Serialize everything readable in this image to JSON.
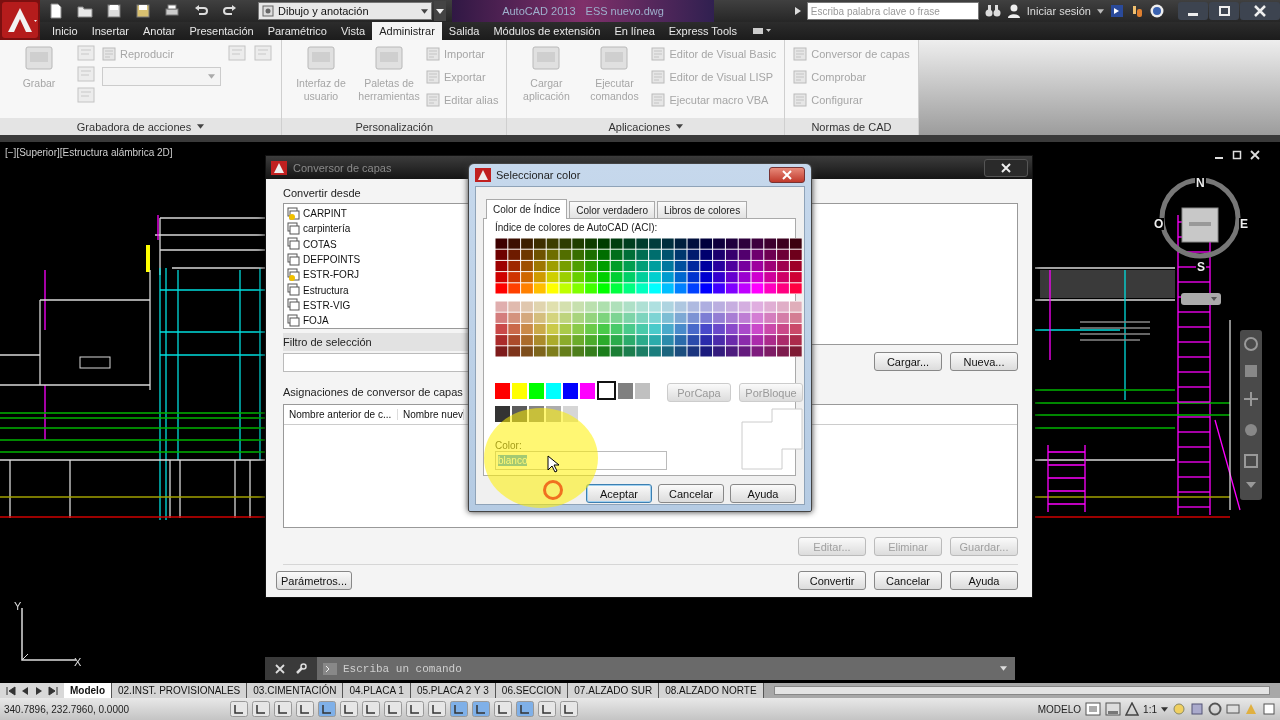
{
  "title_bar": {
    "workspace": "Dibujo y anotación",
    "app": "AutoCAD 2013",
    "file": "ESS nuevo.dwg",
    "search": {
      "placeholder": "Escriba palabra clave o frase"
    },
    "sign_in": "Iniciar sesión"
  },
  "ribbon_tabs": [
    {
      "label": "Inicio",
      "selected": false
    },
    {
      "label": "Insertar",
      "selected": false
    },
    {
      "label": "Anotar",
      "selected": false
    },
    {
      "label": "Presentación",
      "selected": false
    },
    {
      "label": "Paramétrico",
      "selected": false
    },
    {
      "label": "Vista",
      "selected": false
    },
    {
      "label": "Administrar",
      "selected": true
    },
    {
      "label": "Salida",
      "selected": false
    },
    {
      "label": "Módulos de extensión",
      "selected": false
    },
    {
      "label": "En línea",
      "selected": false
    },
    {
      "label": "Express Tools",
      "selected": false
    }
  ],
  "ribbon_panels": [
    {
      "title": "Grabadora de acciones",
      "menu": true,
      "columns": [
        [
          {
            "kind": "large",
            "label": "Grabar"
          }
        ],
        [
          {
            "kind": "icon"
          },
          {
            "kind": "icon"
          },
          {
            "kind": "icon"
          }
        ],
        [
          {
            "kind": "small",
            "label": "Reproducir"
          },
          {
            "kind": "combo"
          }
        ],
        [
          {
            "kind": "icon"
          }
        ],
        [
          {
            "kind": "icon"
          }
        ]
      ]
    },
    {
      "title": "Personalización",
      "menu": false,
      "columns": [
        [
          {
            "kind": "large",
            "label": "Interfaz de usuario"
          }
        ],
        [
          {
            "kind": "large",
            "label": "Paletas de herramientas"
          }
        ],
        [
          {
            "kind": "small",
            "label": "Importar"
          },
          {
            "kind": "small",
            "label": "Exportar"
          },
          {
            "kind": "small",
            "label": "Editar alias"
          }
        ]
      ]
    },
    {
      "title": "Aplicaciones",
      "menu": true,
      "columns": [
        [
          {
            "kind": "large",
            "label": "Cargar aplicación"
          }
        ],
        [
          {
            "kind": "large",
            "label": "Ejecutar comandos"
          }
        ],
        [
          {
            "kind": "small",
            "label": "Editor de Visual Basic"
          },
          {
            "kind": "small",
            "label": "Editor de Visual LISP"
          },
          {
            "kind": "small",
            "label": "Ejecutar macro VBA"
          }
        ]
      ]
    },
    {
      "title": "Normas de CAD",
      "menu": false,
      "columns": [
        [
          {
            "kind": "small",
            "label": "Conversor de capas"
          },
          {
            "kind": "small",
            "label": "Comprobar"
          },
          {
            "kind": "small",
            "label": "Configurar"
          }
        ]
      ]
    }
  ],
  "viewport": {
    "label": "[−][Superior][Estructura alámbrica 2D]"
  },
  "viewcube": {
    "north": "N",
    "east": "E",
    "south": "S",
    "west": "O"
  },
  "ucs": {
    "x": "X",
    "y": "Y"
  },
  "command_line": {
    "placeholder": "Escriba un comando"
  },
  "layout_tabs": [
    {
      "label": "Modelo",
      "selected": true
    },
    {
      "label": "02.INST. PROVISIONALES",
      "selected": false
    },
    {
      "label": "03.CIMENTACIÓN",
      "selected": false
    },
    {
      "label": "04.PLACA 1",
      "selected": false
    },
    {
      "label": "05.PLACA 2 Y 3",
      "selected": false
    },
    {
      "label": "06.SECCION",
      "selected": false
    },
    {
      "label": "07.ALZADO SUR",
      "selected": false
    },
    {
      "label": "08.ALZADO NORTE",
      "selected": false
    }
  ],
  "status_bar": {
    "coordinates": "340.7896, 232.7960, 0.0000",
    "toggles": [
      {
        "on": false
      },
      {
        "on": false
      },
      {
        "on": false
      },
      {
        "on": false
      },
      {
        "on": true
      },
      {
        "on": false
      },
      {
        "on": false
      },
      {
        "on": false
      },
      {
        "on": false
      },
      {
        "on": false
      },
      {
        "on": true
      },
      {
        "on": true
      },
      {
        "on": false
      },
      {
        "on": true
      },
      {
        "on": false
      },
      {
        "on": false
      }
    ],
    "space": "MODELO",
    "scale": "1:1"
  },
  "layer_converter": {
    "title": "Conversor de capas",
    "from_label": "Convertir desde",
    "layers": [
      {
        "name": "CARPINT",
        "locked": true
      },
      {
        "name": "carpintería",
        "locked": false
      },
      {
        "name": "COTAS",
        "locked": false
      },
      {
        "name": "DEFPOINTS",
        "locked": false
      },
      {
        "name": "ESTR-FORJ",
        "locked": true
      },
      {
        "name": "Estructura",
        "locked": false
      },
      {
        "name": "ESTR-VIG",
        "locked": false
      },
      {
        "name": "FOJA",
        "locked": false
      }
    ],
    "filter_label": "Filtro de selección",
    "to_buttons": [
      "Cargar...",
      "Nueva..."
    ],
    "mappings_label": "Asignaciones de conversor de capas",
    "columns": [
      "Nombre anterior de c...",
      "Nombre nuev"
    ],
    "mapping_buttons": [
      {
        "label": "Editar...",
        "disabled": true
      },
      {
        "label": "Eliminar",
        "disabled": true
      },
      {
        "label": "Guardar...",
        "disabled": true
      }
    ],
    "settings_button": "Parámetros...",
    "footer_buttons": [
      "Convertir",
      "Cancelar",
      "Ayuda"
    ]
  },
  "color_dialog": {
    "title": "Seleccionar color",
    "tabs": [
      {
        "label": "Color de Índice",
        "selected": true
      },
      {
        "label": "Color verdadero",
        "selected": false
      },
      {
        "label": "Libros de colores",
        "selected": false
      }
    ],
    "aci_label": "Índice de colores de AutoCAD (ACI):",
    "standard_colors": [
      {
        "color": "#ff0000",
        "selected": false
      },
      {
        "color": "#ffff00",
        "selected": false
      },
      {
        "color": "#00ff00",
        "selected": false
      },
      {
        "color": "#00ffff",
        "selected": false
      },
      {
        "color": "#0000ff",
        "selected": false
      },
      {
        "color": "#ff00ff",
        "selected": false
      },
      {
        "color": "#ffffff",
        "selected": true
      },
      {
        "color": "#808080",
        "selected": false
      },
      {
        "color": "#c0c0c0",
        "selected": false
      }
    ],
    "gray_colors": [
      {
        "color": "#333333",
        "selected": false
      },
      {
        "color": "#5b5b5b",
        "selected": false
      },
      {
        "color": "#848484",
        "selected": false
      },
      {
        "color": "#adadad",
        "selected": false
      },
      {
        "color": "#d6d6d6",
        "selected": false
      }
    ],
    "bylayer": "PorCapa",
    "byblock": "PorBloque",
    "color_label": "Color:",
    "color_value": "blanco",
    "value_selected": true,
    "buttons": [
      "Aceptar",
      "Cancelar",
      "Ayuda"
    ]
  }
}
